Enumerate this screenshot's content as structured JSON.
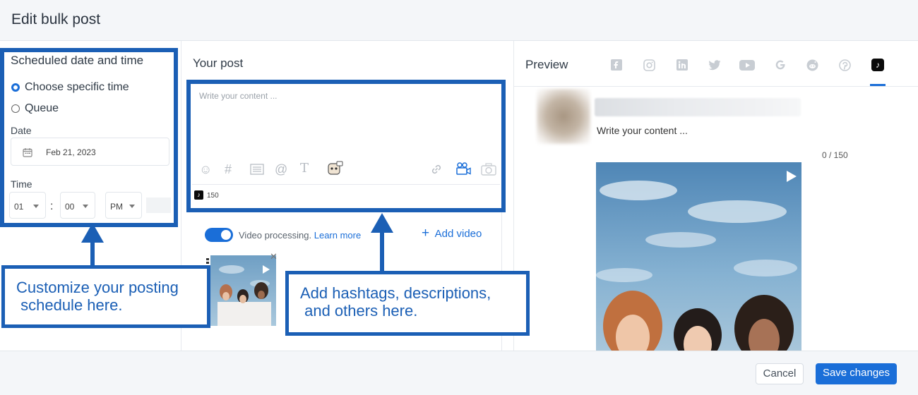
{
  "dialog": {
    "title": "Edit bulk post"
  },
  "schedule": {
    "section_title": "Scheduled date and time",
    "option_specific": "Choose specific time",
    "option_queue": "Queue",
    "date_label": "Date",
    "date_value": "Feb 21, 2023",
    "time_label": "Time",
    "hour": "01",
    "separator": ":",
    "minute": "00",
    "ampm": "PM"
  },
  "post": {
    "section_title": "Your post",
    "placeholder": "Write your content ...",
    "char_limit": "150",
    "video_processing_label": "Video processing.",
    "learn_more": "Learn more",
    "add_video": "Add video",
    "add_video_icon": "+",
    "media_close": "✕"
  },
  "preview": {
    "title": "Preview",
    "content": "Write your content ...",
    "counter": "0 / 150",
    "networks": [
      "facebook-icon",
      "instagram-icon",
      "linkedin-icon",
      "twitter-icon",
      "youtube-icon",
      "google-icon",
      "reddit-icon",
      "pinterest-icon",
      "tiktok-icon"
    ]
  },
  "callouts": {
    "schedule_line1": "Customize your posting",
    "schedule_line2": " schedule here.",
    "post_line1": "Add hashtags, descriptions,",
    "post_line2": " and others here."
  },
  "footer": {
    "cancel": "Cancel",
    "save": "Save changes"
  },
  "colors": {
    "accent": "#1a6ed8",
    "annotation_blue": "#1b5fb5"
  }
}
